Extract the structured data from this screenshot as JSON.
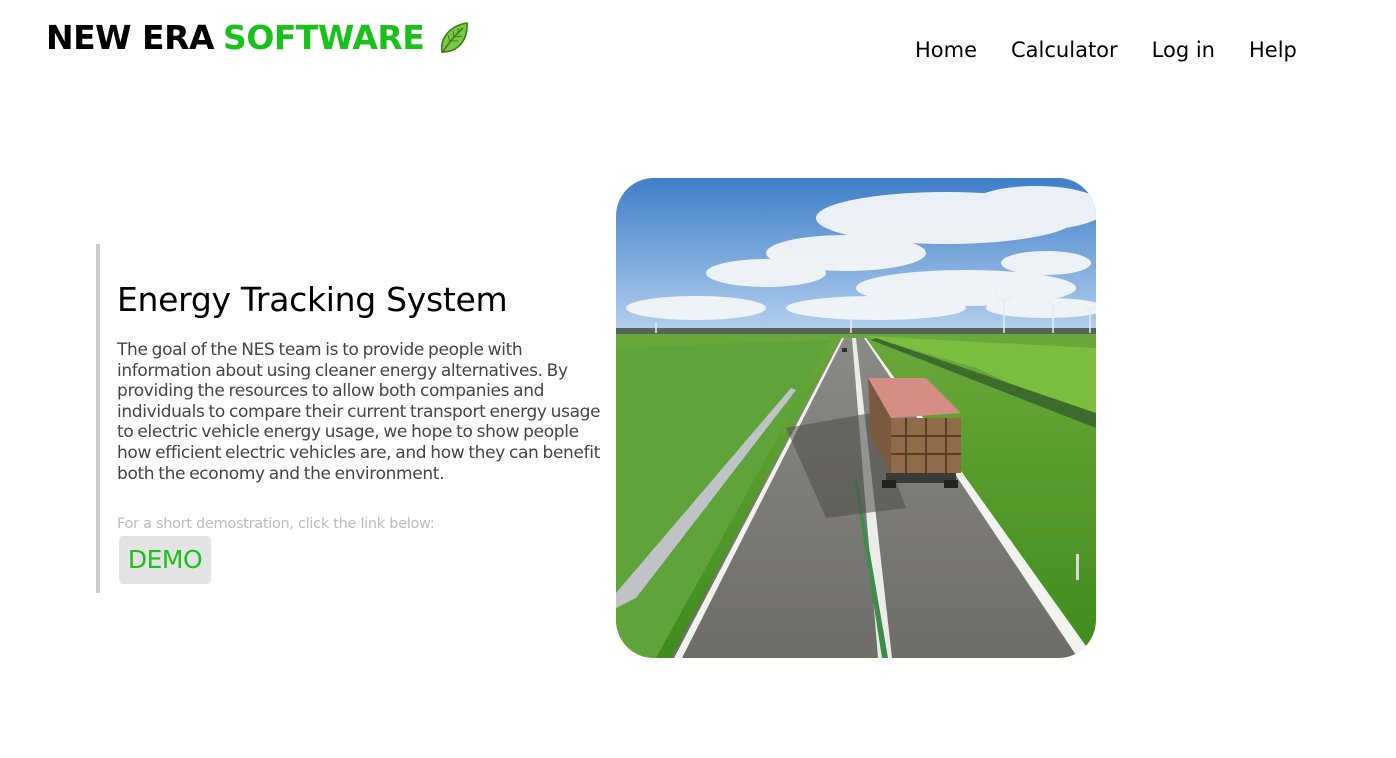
{
  "header": {
    "logo_part1": "NEW ERA",
    "logo_part2": "SOFTWARE",
    "logo_icon": "leaf-icon",
    "nav": [
      "Home",
      "Calculator",
      "Log in",
      "Help"
    ]
  },
  "main": {
    "title": "Energy Tracking System",
    "description": "The goal of the NES team is to provide people with information about using cleaner energy alternatives. By providing the resources to allow both companies and individuals to compare their current transport energy usage to electric vehicle energy usage, we hope to show people how efficient electric vehicles are, and how they can benefit both the economy and the environment.",
    "hint": "For a short demostration, click the link below:",
    "demo_label": "DEMO"
  },
  "colors": {
    "brand_green": "#1ac11a",
    "button_bg": "#e4e4e4",
    "border": "#cccccc"
  }
}
